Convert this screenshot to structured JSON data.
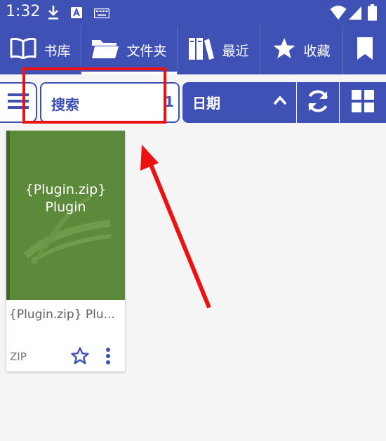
{
  "status_bar": {
    "time": "1:32",
    "icons": [
      "download-icon",
      "a-badge-icon",
      "keyboard-icon",
      "wifi-icon",
      "signal-icon",
      "battery-icon"
    ]
  },
  "nav": {
    "tabs": [
      {
        "label": "书库",
        "icon": "book-open-icon"
      },
      {
        "label": "文件夹",
        "icon": "folder-icon"
      },
      {
        "label": "最近",
        "icon": "books-icon"
      },
      {
        "label": "收藏",
        "icon": "star-icon"
      },
      {
        "label": "",
        "icon": "bookmark-icon"
      }
    ],
    "active_tab_index": 1
  },
  "toolbar": {
    "search_label": "搜索",
    "search_count": "1",
    "sort_label": "日期",
    "sort_icon": "chevron-up-icon",
    "refresh_icon": "refresh-icon",
    "view_icon": "grid-view-icon",
    "menu_icon": "hamburger-menu-icon"
  },
  "books": [
    {
      "cover_line1": "{Plugin.zip}",
      "cover_line2": "Plugin",
      "title": "{Plugin.zip} Plu...",
      "format": "ZIP",
      "cover_color": "#5c8a3a"
    }
  ],
  "colors": {
    "primary": "#3f51b5",
    "annotation": "#ee1111"
  }
}
